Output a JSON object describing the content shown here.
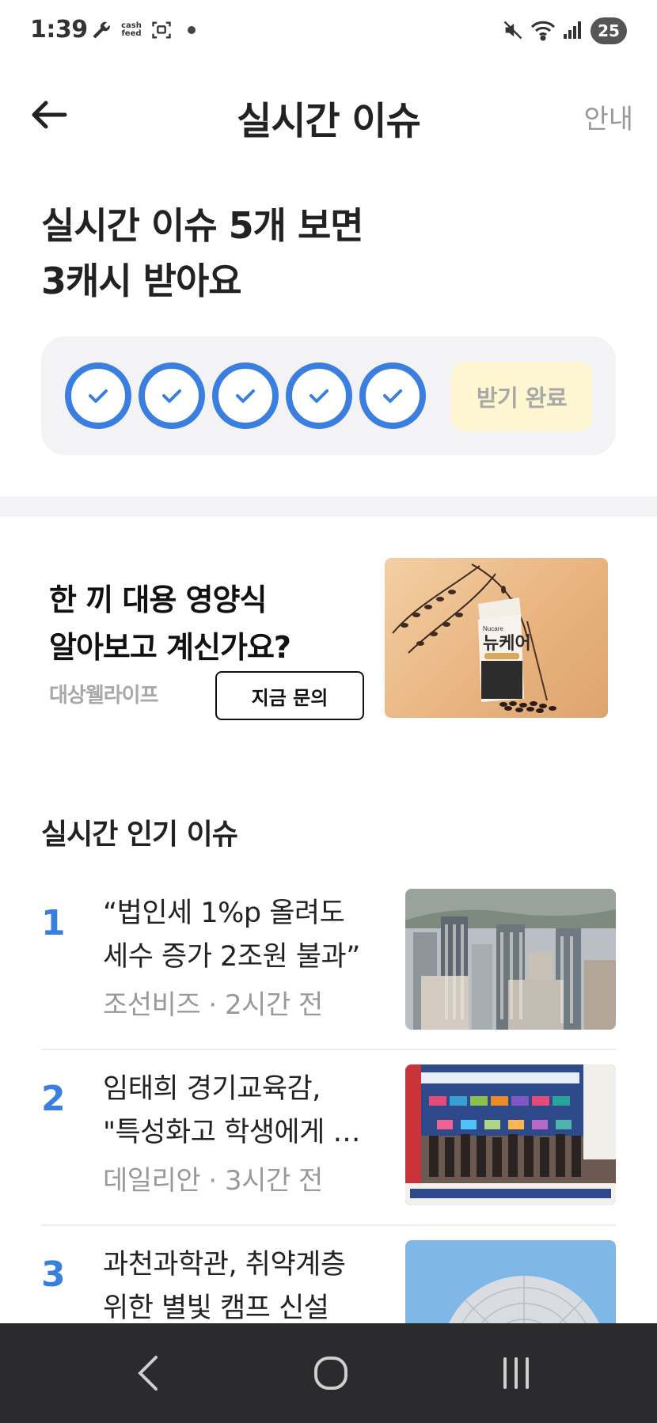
{
  "status_bar": {
    "time": "1:39",
    "cashfeed_label": "cash feed",
    "battery_level": "25"
  },
  "header": {
    "title": "실시간 이슈",
    "guide_label": "안내"
  },
  "reward": {
    "heading_line1": "실시간 이슈 5개 보면",
    "heading_line2": "3캐시 받아요",
    "steps_completed": 5,
    "steps_total": 5,
    "receive_button_label": "받기 완료",
    "accent_color": "#3a7fe0"
  },
  "ad": {
    "headline_line1": "한 끼 대용 영양식",
    "headline_line2": "알아보고 계신가요?",
    "brand": "대상웰라이프",
    "cta_label": "지금 문의",
    "product_brand": "Nucare",
    "product_name": "뉴케어"
  },
  "issues": {
    "section_title": "실시간 인기 이슈",
    "items": [
      {
        "rank": "1",
        "title_line1": "“법인세 1%p 올려도",
        "title_line2": "세수 증가 2조원 불과”",
        "meta": "조선비즈 · 2시간 전"
      },
      {
        "rank": "2",
        "title_line1": "임태희 경기교육감,",
        "title_line2": "\"특성화고 학생에게 …",
        "meta": "데일리안 · 3시간 전"
      },
      {
        "rank": "3",
        "title_line1": "과천과학관, 취약계층",
        "title_line2": "위한 별빛 캠프 신설",
        "meta": ""
      }
    ]
  }
}
